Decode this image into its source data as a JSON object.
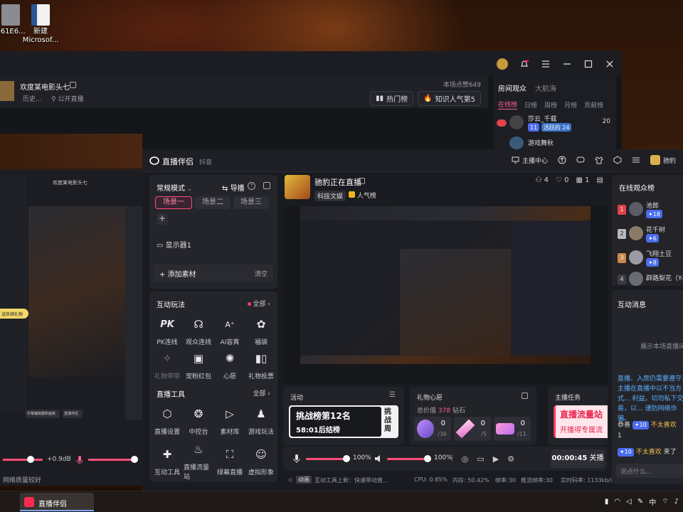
{
  "desktop": {
    "icons": [
      {
        "label": "561E6..."
      },
      {
        "label": "新建 Microsof..."
      }
    ]
  },
  "bg_window": {
    "title": "欢度某电影头七",
    "sub_left": "历史...",
    "sub_right": "公开直播",
    "likes": "本场点赞649",
    "hot_rank": "热门榜",
    "popular_rank": "知识人气第5",
    "side_tabs": [
      "房间观众",
      "大航海"
    ],
    "side_subtabs": [
      "在线榜",
      "日榜",
      "周榜",
      "月榜",
      "贡献榜"
    ],
    "viewers": [
      {
        "name": "莎云_千载",
        "badge": "11",
        "guard": "活跃的 24",
        "score": "20"
      },
      {
        "name": "游戏舞秋",
        "badge": "",
        "guard": "",
        "score": ""
      }
    ]
  },
  "mini": {
    "title": "欢度某电影头七",
    "gift_label": "送热销礼物",
    "volume": "+0.9dB",
    "status": "网络质量较好",
    "tabs": [
      "字幕编辑器新面板",
      "直播伴侣"
    ]
  },
  "app": {
    "logo": "直播伴侣",
    "sub": "抖音",
    "header_right": [
      "主播中心"
    ],
    "header_user": "驰豹",
    "mode": "常规模式",
    "guide": "导播",
    "scenes": [
      "场景一",
      "场景二",
      "场景三"
    ],
    "source": "显示器1",
    "add_source": "添加素材",
    "clear": "清空",
    "interact_title": "互动玩法",
    "all": "全部",
    "tools_row1": [
      "PK连线",
      "观众连线",
      "AI容真",
      "福袋"
    ],
    "tools_row2": [
      "礼物带带",
      "宠粉红包",
      "心愿",
      "礼物投票"
    ],
    "live_tools_title": "直播工具",
    "tools_row3": [
      "直播设置",
      "中控台",
      "素材库",
      "游戏玩法"
    ],
    "tools_row4": [
      "互动工具",
      "直播流量站",
      "绿幕直播",
      "虚拟形象"
    ],
    "live": {
      "title": "驰豹正在直播",
      "tags": [
        "科技文娱",
        "人气榜"
      ],
      "viewers": "4",
      "likes": "0",
      "calendar": "1"
    },
    "activity": {
      "title": "活动",
      "rank": "挑战榜第12名",
      "timer": "58:01后结榜",
      "side": "挑战周"
    },
    "wish": {
      "title": "礼物心愿",
      "total_label": "总价值",
      "total_value": "378",
      "total_unit": "钻石",
      "items": [
        {
          "count": "0",
          "of": "/36"
        },
        {
          "count": "0",
          "of": "/5"
        },
        {
          "count": "0",
          "of": "/11"
        }
      ]
    },
    "task": {
      "title": "主播任务",
      "main": "直播流量站",
      "sub": "开播得专属流"
    },
    "mixer": {
      "mic": "100%",
      "speaker": "100%",
      "time": "00:00:45",
      "stop": "关播"
    },
    "statusbar": {
      "tag": "动画",
      "text": "互动工具上新：快速带动直...",
      "cpu": "CPU: 0.85%",
      "mem": "内存: 50.42%",
      "fps": "帧率:30",
      "push_fps": "推流帧率:30",
      "bitrate": "实时码率: 1133kb/s"
    }
  },
  "audience": {
    "title": "在线观众榜",
    "items": [
      {
        "rank": "1",
        "name": "池郎",
        "badge": "18"
      },
      {
        "rank": "2",
        "name": "花千树",
        "badge": "6"
      },
      {
        "rank": "3",
        "name": "飞翔土豆",
        "badge": "8"
      },
      {
        "rank": "4",
        "name": "辟路梨花（Y-",
        "badge": ""
      }
    ]
  },
  "messages": {
    "title": "互动消息",
    "empty": "展示本场直播间",
    "notice": "直播、入房仍需要遵守... 主播在直播中以不当方式... 利益。切勿私下交易，以... 谨防网络诈骗。",
    "m1_name": "恭喜",
    "m1_badge": "10",
    "m1_text": "不太喜欢",
    "m1_num": "1",
    "m2_badge": "10",
    "m2_name": "不太喜欢",
    "m2_text": "来了",
    "input": "说点什么..."
  },
  "taskbar": {
    "app": "直播伴侣",
    "ime": "中"
  }
}
